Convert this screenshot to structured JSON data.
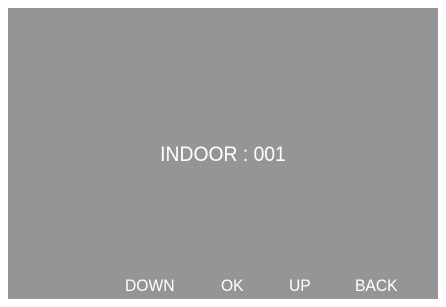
{
  "display": {
    "main_text": "INDOOR : 001",
    "background_color": "#949597",
    "text_color": "#ffffff"
  },
  "softkeys": {
    "down": "DOWN",
    "ok": "OK",
    "up": "UP",
    "back": "BACK"
  }
}
